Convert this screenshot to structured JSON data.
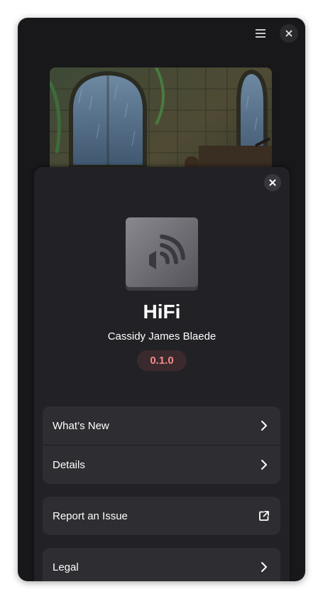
{
  "app": {
    "name": "HiFi",
    "developer": "Cassidy James Blaede",
    "version": "0.1.0"
  },
  "rows": {
    "whats_new": "What’s New",
    "details": "Details",
    "report_issue": "Report an Issue",
    "legal": "Legal"
  },
  "icons": {
    "menu": "hamburger-menu-icon",
    "close": "close-icon",
    "chevron": "chevron-right-icon",
    "external": "external-link-icon",
    "app": "speaker-icon"
  },
  "colors": {
    "window_bg": "#18181b",
    "sheet_bg": "#222226",
    "row_bg": "#2e2e32",
    "version_text": "#f28b8b",
    "version_bg": "#3a2a2e"
  }
}
